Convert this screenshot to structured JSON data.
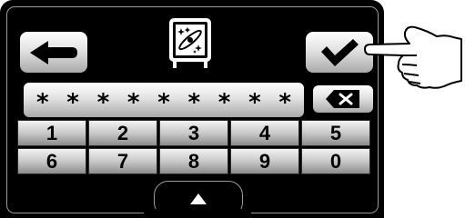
{
  "password": {
    "masked_chars": [
      "*",
      "*",
      "*",
      "*",
      "*",
      "*",
      "*",
      "*",
      "*"
    ]
  },
  "keypad": {
    "row1": [
      "1",
      "2",
      "3",
      "4",
      "5"
    ],
    "row2": [
      "6",
      "7",
      "8",
      "9",
      "0"
    ]
  },
  "icons": {
    "back": "arrow-left-icon",
    "confirm": "checkmark-icon",
    "delete": "backspace-icon",
    "app": "propeller-sparkle-icon",
    "expand": "triangle-up-icon",
    "pointer": "pointing-hand-icon"
  },
  "colors": {
    "screen_bg": "#000000",
    "button_silver": "#d8d8d8",
    "glyph": "#000000"
  }
}
